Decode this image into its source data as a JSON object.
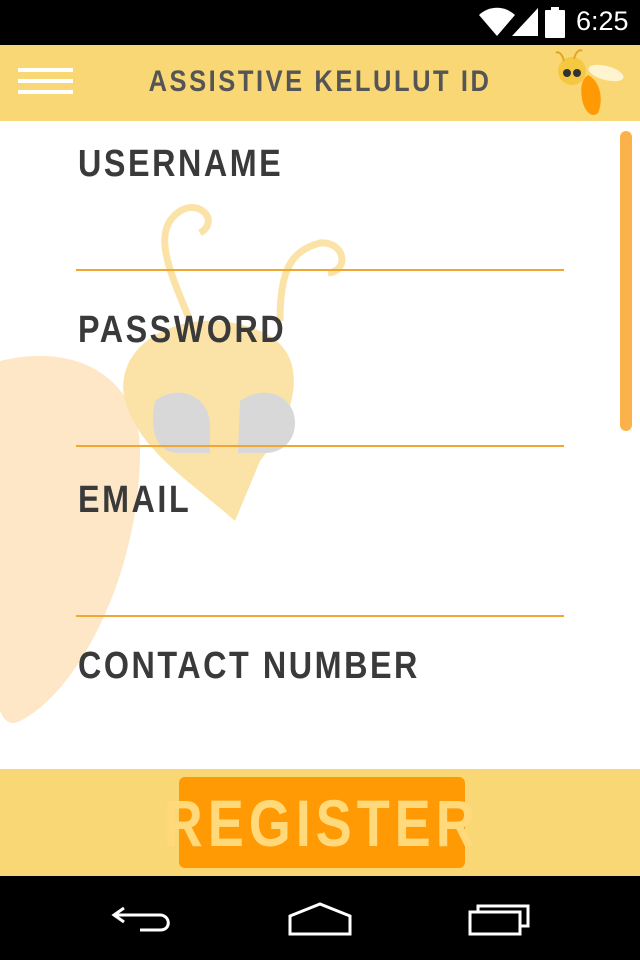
{
  "status_bar": {
    "time": "6:25",
    "icons": [
      "wifi-icon",
      "cell-signal-icon",
      "battery-icon"
    ]
  },
  "app_bar": {
    "menu_icon": "hamburger-menu-icon",
    "title": "ASSISTIVE KELULUT ID",
    "logo_icon": "bee-logo-icon"
  },
  "form": {
    "fields": [
      {
        "label": "USERNAME",
        "value": ""
      },
      {
        "label": "PASSWORD",
        "value": ""
      },
      {
        "label": "EMAIL",
        "value": ""
      },
      {
        "label": "CONTACT NUMBER",
        "value": ""
      }
    ],
    "background_icon": "bee-watermark-icon"
  },
  "footer": {
    "register_label": "REGISTER"
  },
  "nav_bar": {
    "icons": [
      "back-icon",
      "home-icon",
      "recent-apps-icon"
    ]
  },
  "colors": {
    "app_bar": "#f9d774",
    "accent": "#ff9a05",
    "underline": "#f0a630",
    "scrollbar": "#fbb24a",
    "label_text": "#3a3a3a"
  }
}
